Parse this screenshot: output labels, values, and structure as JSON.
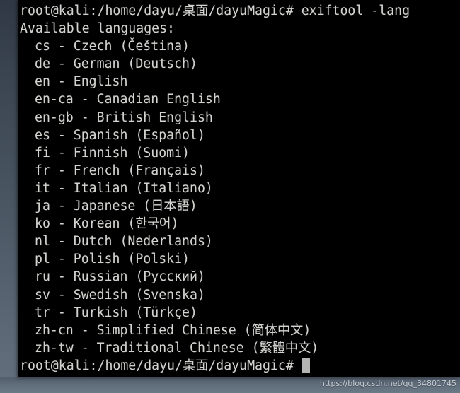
{
  "terminal": {
    "prompt_command_line": "root@kali:/home/dayu/桌面/dayuMagic# exiftool -lang",
    "header_line": "Available languages:",
    "languages": [
      {
        "line": "cs - Czech (Čeština)"
      },
      {
        "line": "de - German (Deutsch)"
      },
      {
        "line": "en - English"
      },
      {
        "line": "en-ca - Canadian English"
      },
      {
        "line": "en-gb - British English"
      },
      {
        "line": "es - Spanish (Español)"
      },
      {
        "line": "fi - Finnish (Suomi)"
      },
      {
        "line": "fr - French (Français)"
      },
      {
        "line": "it - Italian (Italiano)"
      },
      {
        "line": "ja - Japanese (日本語)"
      },
      {
        "line": "ko - Korean (한국어)"
      },
      {
        "line": "nl - Dutch (Nederlands)"
      },
      {
        "line": "pl - Polish (Polski)"
      },
      {
        "line": "ru - Russian (Русский)"
      },
      {
        "line": "sv - Swedish (Svenska)"
      },
      {
        "line": "tr - Turkish (Türkçe)"
      },
      {
        "line": "zh-cn - Simplified Chinese (简体中文)"
      },
      {
        "line": "zh-tw - Traditional Chinese (繁體中文)"
      }
    ],
    "final_prompt": "root@kali:/home/dayu/桌面/dayuMagic# ",
    "colors": {
      "background": "#000000",
      "foreground": "#d2d2cf",
      "cursor": "#b4b4b2"
    }
  },
  "watermark": {
    "text": "https://blog.csdn.net/qq_34801745"
  }
}
